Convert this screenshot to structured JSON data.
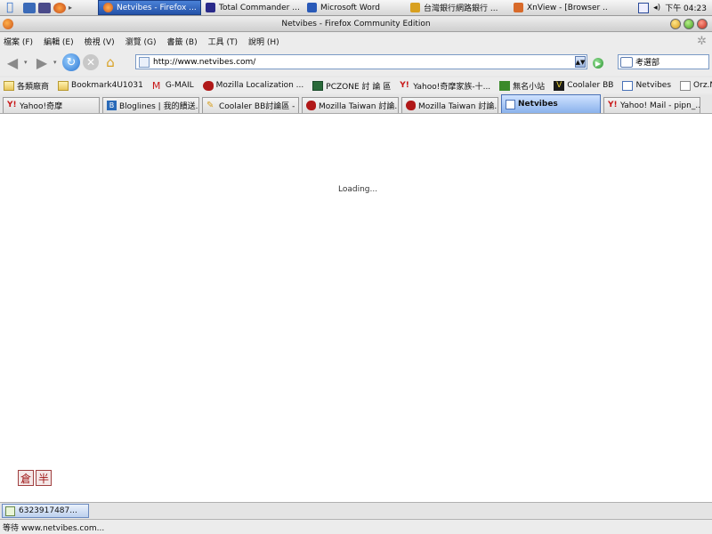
{
  "os_bar": {
    "tasks": [
      {
        "label": "Netvibes - Firefox ...",
        "icon": "firefox-icon",
        "color": "#e06a1a",
        "active": true
      },
      {
        "label": "Total Commander ...",
        "icon": "floppy-disk-icon",
        "color": "#2a2a8a",
        "active": false
      },
      {
        "label": "Microsoft Word",
        "icon": "word-icon",
        "color": "#2a5ab8",
        "active": false
      },
      {
        "label": "台灣銀行網路銀行 ...",
        "icon": "web-page-icon",
        "color": "#d8a020",
        "active": false
      },
      {
        "label": "XnView - [Browser ...",
        "icon": "xnview-icon",
        "color": "#d86a2a",
        "active": false
      }
    ],
    "clock": "下午 04:23"
  },
  "window": {
    "title": "Netvibes - Firefox Community Edition"
  },
  "menu": {
    "items": [
      "檔案 (F)",
      "編輯 (E)",
      "檢視 (V)",
      "瀏覽 (G)",
      "書籤 (B)",
      "工具 (T)",
      "說明 (H)"
    ]
  },
  "navbar": {
    "url": "http://www.netvibes.com/",
    "search_value": "考選部"
  },
  "bookmarks": {
    "items": [
      {
        "label": "各類廠商",
        "icon": "folder-icon"
      },
      {
        "label": "Bookmark4U1031",
        "icon": "folder-icon"
      },
      {
        "label": "G-MAIL",
        "icon": "gmail-icon"
      },
      {
        "label": "Mozilla Localization ...",
        "icon": "mozilla-icon"
      },
      {
        "label": "PCZONE 討 論 區",
        "icon": "pczone-icon"
      },
      {
        "label": "Yahoo!奇摩家族-十...",
        "icon": "yahoo-icon"
      },
      {
        "label": "無名小站",
        "icon": "wretch-icon"
      },
      {
        "label": "Coolaler BB",
        "icon": "coolaler-icon"
      },
      {
        "label": "Netvibes",
        "icon": "netvibes-icon"
      },
      {
        "label": "Orz.NET",
        "icon": "page-icon"
      }
    ],
    "overflow": "»"
  },
  "tabs": [
    {
      "label": "Yahoo!奇摩",
      "icon": "yahoo-icon",
      "active": false
    },
    {
      "label": "Bloglines | 我的饋送...",
      "icon": "bloglines-icon",
      "active": false
    },
    {
      "label": "Coolaler BB討論區 - ...",
      "icon": "coolaler-icon",
      "active": false
    },
    {
      "label": "Mozilla Taiwan 討論...",
      "icon": "mozilla-icon",
      "active": false
    },
    {
      "label": "Mozilla Taiwan 討論...",
      "icon": "mozilla-icon",
      "active": false
    },
    {
      "label": "Netvibes",
      "icon": "netvibes-icon",
      "active": true
    },
    {
      "label": "Yahoo! Mail - pipn_...",
      "icon": "yahoo-icon",
      "active": false
    }
  ],
  "content": {
    "loading_text": "Loading...",
    "ime_buttons": [
      "倉",
      "半"
    ]
  },
  "download": {
    "label": "6323917487..."
  },
  "status": {
    "text": "等待 www.netvibes.com..."
  },
  "colors": {
    "accent": "#2452a8",
    "yahoo_red": "#c81818",
    "mozilla_red": "#b01818"
  }
}
